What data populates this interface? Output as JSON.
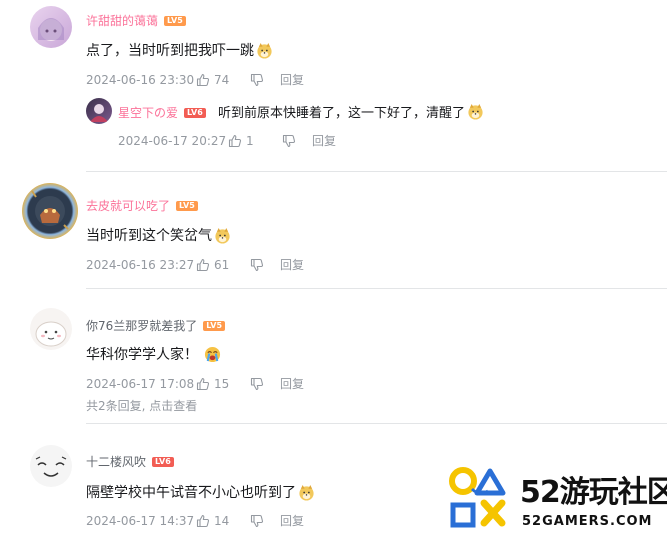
{
  "comments": [
    {
      "username": "许甜甜的蔼蔼",
      "level": "LV5",
      "text": "点了，当时听到把我吓一跳",
      "time": "2024-06-16 23:30",
      "likes": "74",
      "reply_label": "回复",
      "name_color": "#fb7299",
      "reply": {
        "username": "星空下の爱",
        "level": "LV6",
        "text": "听到前原本快睡着了，这一下好了，清醒了",
        "time": "2024-06-17 20:27",
        "likes": "1",
        "reply_label": "回复",
        "name_color": "#fb7299"
      }
    },
    {
      "username": "去皮就可以吃了",
      "level": "LV5",
      "text": "当时听到这个笑岔气",
      "time": "2024-06-16 23:27",
      "likes": "61",
      "reply_label": "回复",
      "name_color": "#fb7299"
    },
    {
      "username": "你76兰那罗就差我了",
      "level": "LV5",
      "text": "华科你学学人家！",
      "time": "2024-06-17 17:08",
      "likes": "15",
      "reply_label": "回复",
      "name_color": "#61666d",
      "sub_hint": "共2条回复, 点击查看"
    },
    {
      "username": "十二楼风吹",
      "level": "LV6",
      "text": "隔壁学校中午试音不小心也听到了",
      "time": "2024-06-17 14:37",
      "likes": "14",
      "reply_label": "回复",
      "name_color": "#61666d"
    }
  ],
  "watermark": {
    "title": "52游玩社区",
    "subtitle": "52GAMERS.COM"
  },
  "colors": {
    "pink_name": "#fb7299",
    "meta_gray": "#9499a0",
    "lv5": "#ff9a4c",
    "lv6": "#f25d54",
    "logo_yellow": "#f5c400",
    "logo_blue": "#2a6fd6"
  }
}
